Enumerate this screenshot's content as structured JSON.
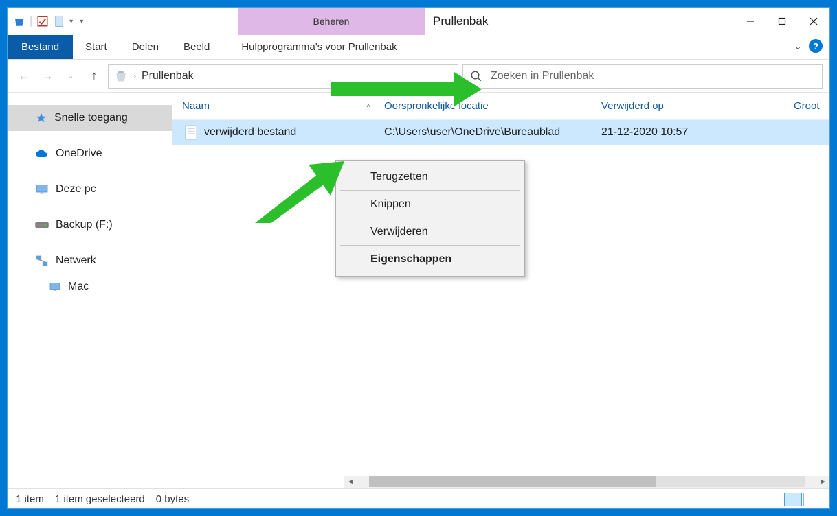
{
  "window": {
    "context_tab_group": "Beheren",
    "title": "Prullenbak"
  },
  "ribbon": {
    "file": "Bestand",
    "tabs": [
      "Start",
      "Delen",
      "Beeld"
    ],
    "context_tab": "Hulpprogramma's voor Prullenbak"
  },
  "address": {
    "location": "Prullenbak"
  },
  "search": {
    "placeholder": "Zoeken in Prullenbak"
  },
  "sidebar": {
    "items": [
      {
        "label": "Snelle toegang",
        "icon": "star",
        "selected": true
      },
      {
        "label": "OneDrive",
        "icon": "cloud"
      },
      {
        "label": "Deze pc",
        "icon": "monitor"
      },
      {
        "label": "Backup (F:)",
        "icon": "drive"
      },
      {
        "label": "Netwerk",
        "icon": "network"
      },
      {
        "label": "Mac",
        "icon": "monitor",
        "child": true
      }
    ]
  },
  "columns": {
    "name": "Naam",
    "location": "Oorspronkelijke locatie",
    "deleted": "Verwijderd op",
    "size": "Groot"
  },
  "rows": [
    {
      "name": "verwijderd bestand",
      "location": "C:\\Users\\user\\OneDrive\\Bureaublad",
      "deleted": "21-12-2020 10:57"
    }
  ],
  "context_menu": {
    "items": [
      "Terugzetten",
      "Knippen",
      "Verwijderen",
      "Eigenschappen"
    ]
  },
  "status": {
    "count": "1 item",
    "selected": "1 item geselecteerd",
    "size": "0 bytes"
  }
}
